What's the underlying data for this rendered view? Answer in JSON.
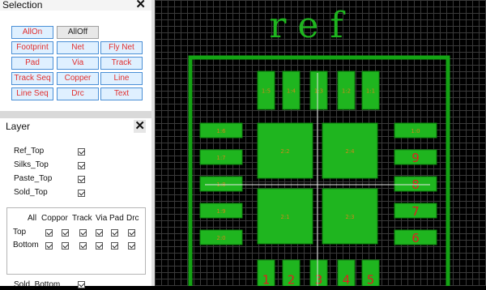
{
  "selection": {
    "title": "Selection",
    "buttons": [
      {
        "label": "AllOn",
        "on": true
      },
      {
        "label": "AllOff",
        "on": false
      },
      {
        "label": "Footprint",
        "on": true
      },
      {
        "label": "Net",
        "on": true
      },
      {
        "label": "Fly Net",
        "on": true
      },
      {
        "label": "Pad",
        "on": true
      },
      {
        "label": "Via",
        "on": true
      },
      {
        "label": "Track",
        "on": true
      },
      {
        "label": "Track Seq",
        "on": true
      },
      {
        "label": "Copper",
        "on": true
      },
      {
        "label": "Line",
        "on": true
      },
      {
        "label": "Line Seq",
        "on": true
      },
      {
        "label": "Drc",
        "on": true
      },
      {
        "label": "Text",
        "on": true
      }
    ]
  },
  "layer": {
    "title": "Layer",
    "layers": [
      {
        "label": "Ref_Top",
        "checked": true
      },
      {
        "label": "Silks_Top",
        "checked": true
      },
      {
        "label": "Paste_Top",
        "checked": true
      },
      {
        "label": "Sold_Top",
        "checked": true
      }
    ],
    "group": {
      "columns": [
        "All",
        "Coppor",
        "Track",
        "Via",
        "Pad",
        "Drc"
      ],
      "rows": [
        "Top",
        "Bottom"
      ]
    },
    "extra_layer": {
      "label": "Sold_Bottom",
      "checked": true
    }
  },
  "pcb": {
    "ref_text": "ref",
    "colors": {
      "copper": "#1fb51f",
      "outline": "#14a314",
      "label_red": "#e02020",
      "pad_label": "#c98a1a",
      "crosshair": "#e6e6e6"
    },
    "top_pads": [
      "1:5",
      "1:4",
      "1:3",
      "1:2",
      "1:1"
    ],
    "left_pads": [
      "1:6",
      "1:7",
      "1:8",
      "1:9",
      "2:0"
    ],
    "right_pads": [
      "1:0",
      "9",
      "8",
      "7",
      "6"
    ],
    "center_pads": [
      "2:2",
      "2:4",
      "2:1",
      "2:3"
    ],
    "bottom_pads": [
      "1",
      "2",
      "3",
      "4",
      "5"
    ]
  }
}
